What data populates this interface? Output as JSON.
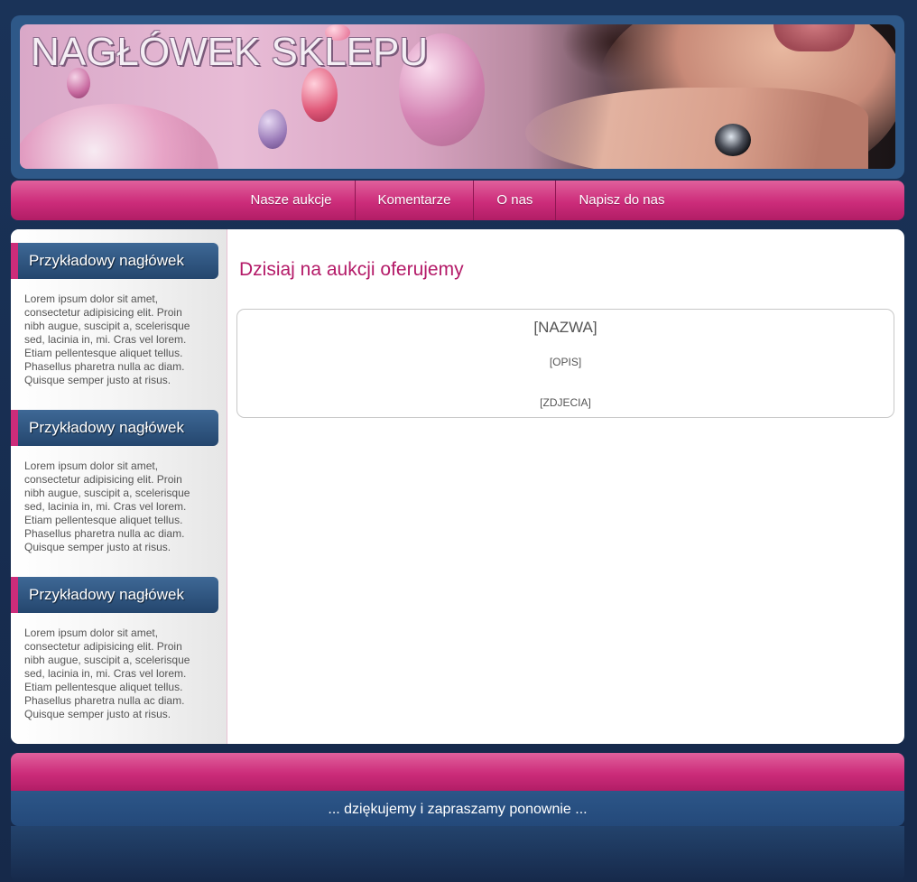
{
  "header": {
    "banner_title": "NAGŁÓWEK SKLEPU"
  },
  "nav": {
    "items": [
      "Nasze aukcje",
      "Komentarze",
      "O nas",
      "Napisz do nas"
    ]
  },
  "sidebar": {
    "boxes": [
      {
        "heading": "Przykładowy nagłówek",
        "text": "Lorem ipsum dolor sit amet, consectetur adipisicing elit. Proin nibh augue, suscipit a, scelerisque sed, lacinia in, mi. Cras vel lorem. Etiam pellentesque aliquet tellus. Phasellus pharetra nulla ac diam. Quisque semper justo at risus."
      },
      {
        "heading": "Przykładowy nagłówek",
        "text": "Lorem ipsum dolor sit amet, consectetur adipisicing elit. Proin nibh augue, suscipit a, scelerisque sed, lacinia in, mi. Cras vel lorem. Etiam pellentesque aliquet tellus. Phasellus pharetra nulla ac diam. Quisque semper justo at risus."
      },
      {
        "heading": "Przykładowy nagłówek",
        "text": "Lorem ipsum dolor sit amet, consectetur adipisicing elit. Proin nibh augue, suscipit a, scelerisque sed, lacinia in, mi. Cras vel lorem. Etiam pellentesque aliquet tellus. Phasellus pharetra nulla ac diam. Quisque semper justo at risus."
      }
    ]
  },
  "main": {
    "title": "Dzisiaj na aukcji oferujemy",
    "offer": {
      "name": "[NAZWA]",
      "description": "[OPIS]",
      "photos": "[ZDJECIA]"
    }
  },
  "footer": {
    "text": "... dziękujemy i zapraszamy ponownie ..."
  },
  "colors": {
    "background": "#1a3358",
    "accent_pink": "#cc2c7a",
    "title_pink": "#b41a68",
    "header_blue": "#2e5888"
  }
}
